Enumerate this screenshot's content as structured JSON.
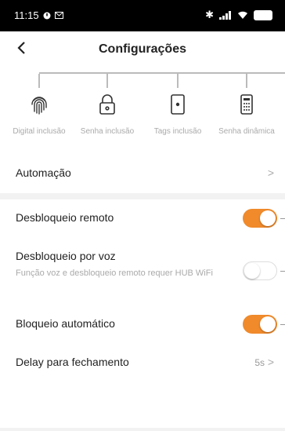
{
  "status_bar": {
    "time": "11:15"
  },
  "header": {
    "title": "Configurações",
    "back_label": "<"
  },
  "shortcuts": [
    {
      "label": "Digital inclusão",
      "icon": "fingerprint-icon"
    },
    {
      "label": "Senha inclusão",
      "icon": "lock-icon"
    },
    {
      "label": "Tags inclusão",
      "icon": "card-tag-icon"
    },
    {
      "label": "Senha dinâmica",
      "icon": "keypad-icon"
    }
  ],
  "automation": {
    "label": "Automação",
    "chevron": ">"
  },
  "remote_unlock": {
    "label": "Desbloqueio remoto",
    "enabled": true
  },
  "voice_unlock": {
    "label": "Desbloqueio por voz",
    "description": "Função voz e desbloqueio remoto requer HUB WiFi",
    "enabled": false
  },
  "auto_lock": {
    "label": "Bloqueio automático",
    "enabled": true
  },
  "close_delay": {
    "label": "Delay para fechamento",
    "value": "5s",
    "chevron": ">"
  },
  "colors": {
    "accent": "#f08a2b",
    "background": "#f2f2f2",
    "card": "#ffffff"
  }
}
